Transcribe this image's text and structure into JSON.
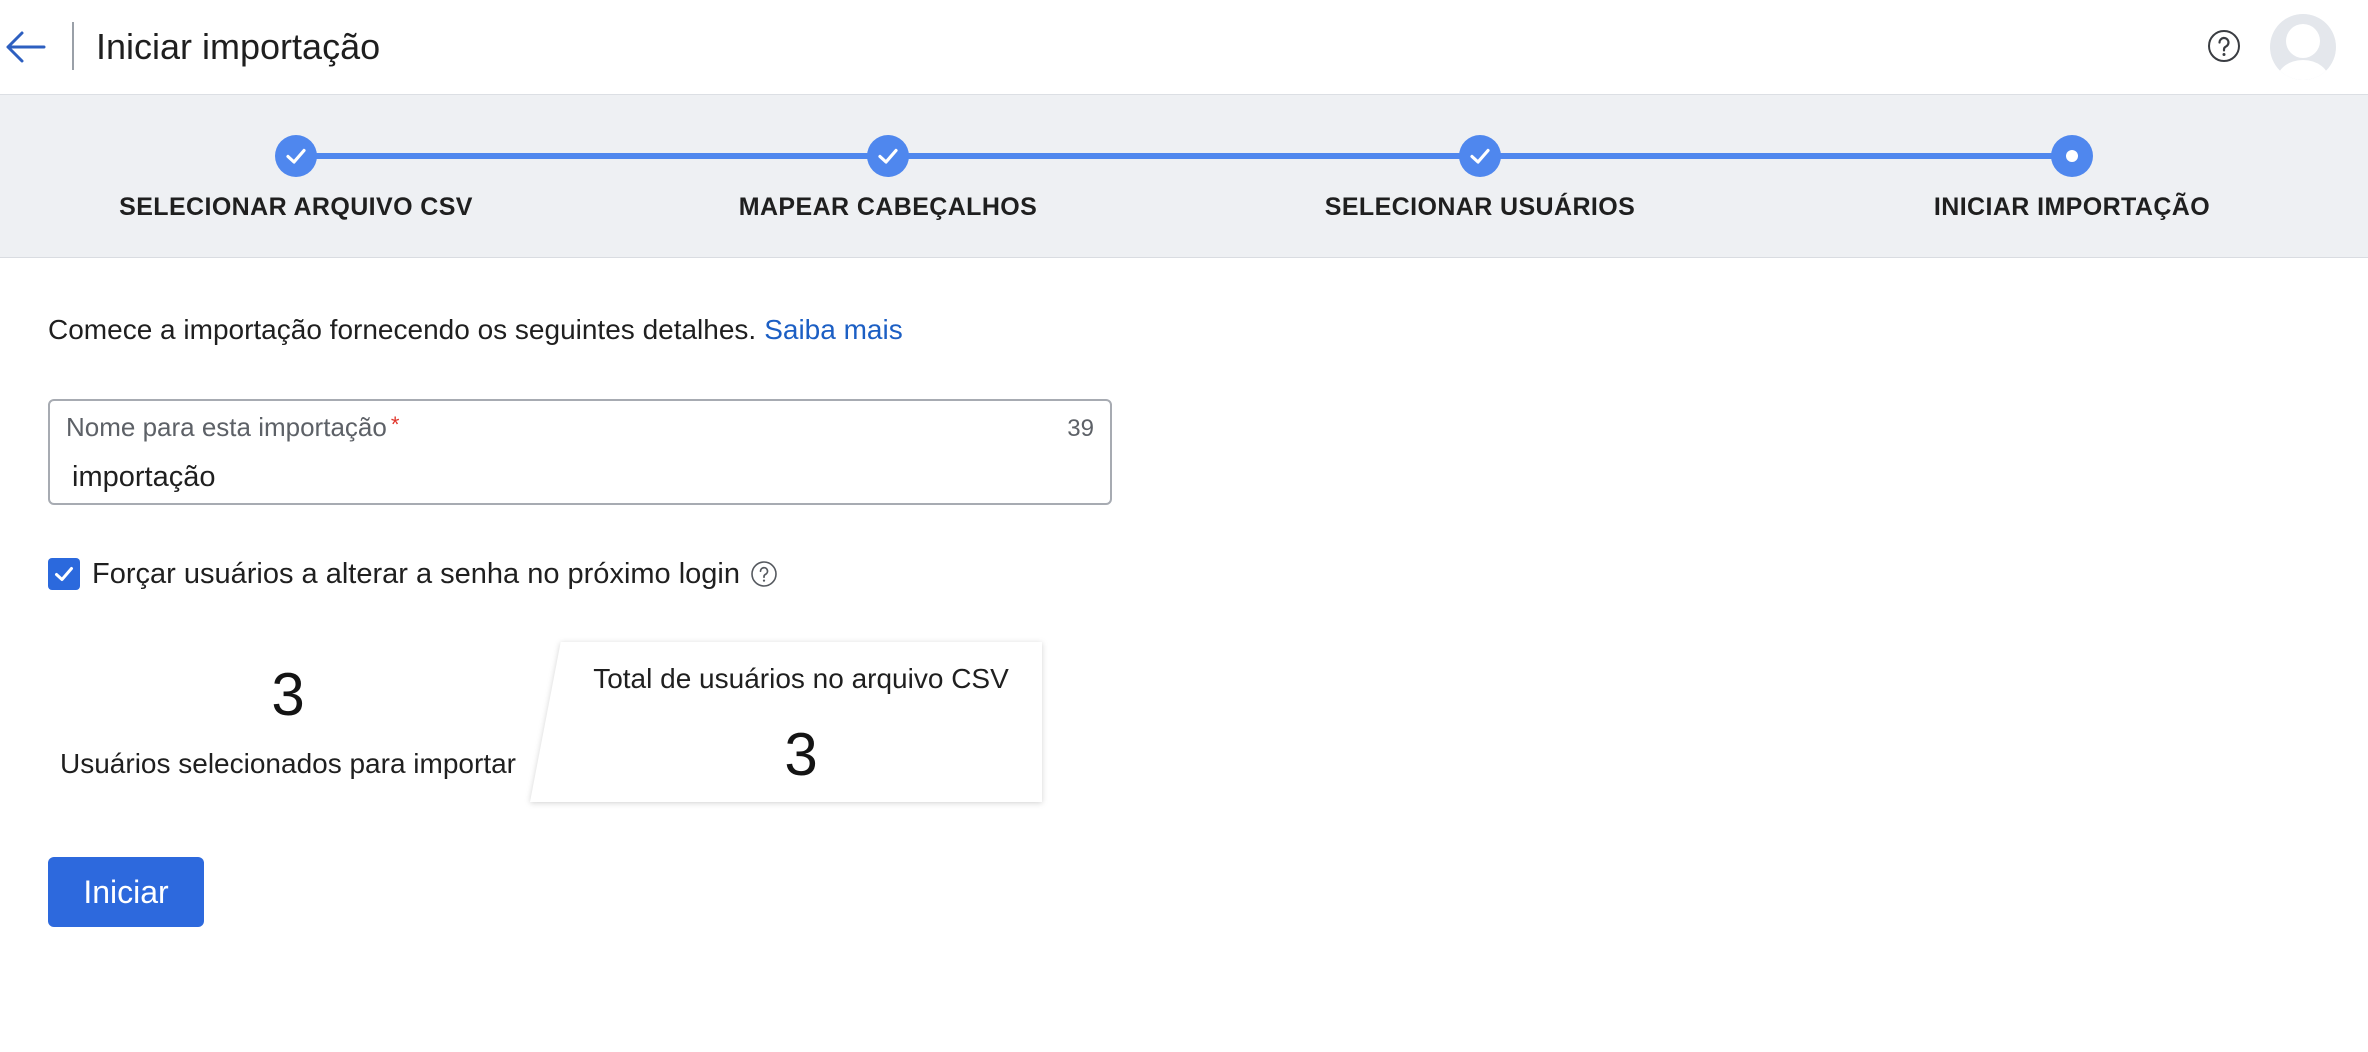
{
  "header": {
    "title": "Iniciar importação",
    "back_icon": "arrow-left-icon",
    "help_icon": "question-circle-icon",
    "avatar_icon": "user-avatar-icon"
  },
  "stepper": {
    "accent_color": "#4f87ee",
    "steps": [
      {
        "label": "SELECIONAR ARQUIVO CSV",
        "state": "completed"
      },
      {
        "label": "MAPEAR CABEÇALHOS",
        "state": "completed"
      },
      {
        "label": "SELECIONAR USUÁRIOS",
        "state": "completed"
      },
      {
        "label": "INICIAR IMPORTAÇÃO",
        "state": "current"
      }
    ]
  },
  "intro": {
    "text": "Comece a importação fornecendo os seguintes detalhes.",
    "link_label": "Saiba mais"
  },
  "name_field": {
    "label": "Nome para esta importação",
    "required_marker": "*",
    "char_count": "39",
    "value": "importação"
  },
  "force_password": {
    "label": "Forçar usuários a alterar a senha no próximo login",
    "checked": true
  },
  "stats": {
    "selected_count": "3",
    "selected_label": "Usuários selecionados para importar",
    "total_label": "Total de usuários no arquivo CSV",
    "total_count": "3"
  },
  "actions": {
    "start_label": "Iniciar",
    "primary_color": "#2d69dd"
  }
}
